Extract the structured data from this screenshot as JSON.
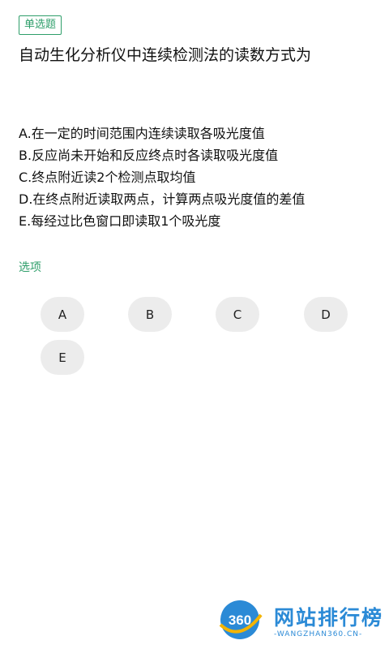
{
  "question_type": "单选题",
  "question": "自动生化分析仪中连续检测法的读数方式为",
  "options": [
    "A.在一定的时间范围内连续读取各吸光度值",
    "B.反应尚未开始和反应终点时各读取吸光度值",
    "C.终点附近读2个检测点取均值",
    "D.在终点附近读取两点，计算两点吸光度值的差值",
    "E.每经过比色窗口即读取1个吸光度"
  ],
  "section_label": "选项",
  "choices": [
    "A",
    "B",
    "C",
    "D",
    "E"
  ],
  "watermark": {
    "logo_text": "360",
    "title": "网站排行榜",
    "subtitle": "-WANGZHAN360.CN-"
  },
  "colors": {
    "accent": "#2e9e6a",
    "choice_bg": "#ececec",
    "watermark": "#2b8ad6"
  }
}
